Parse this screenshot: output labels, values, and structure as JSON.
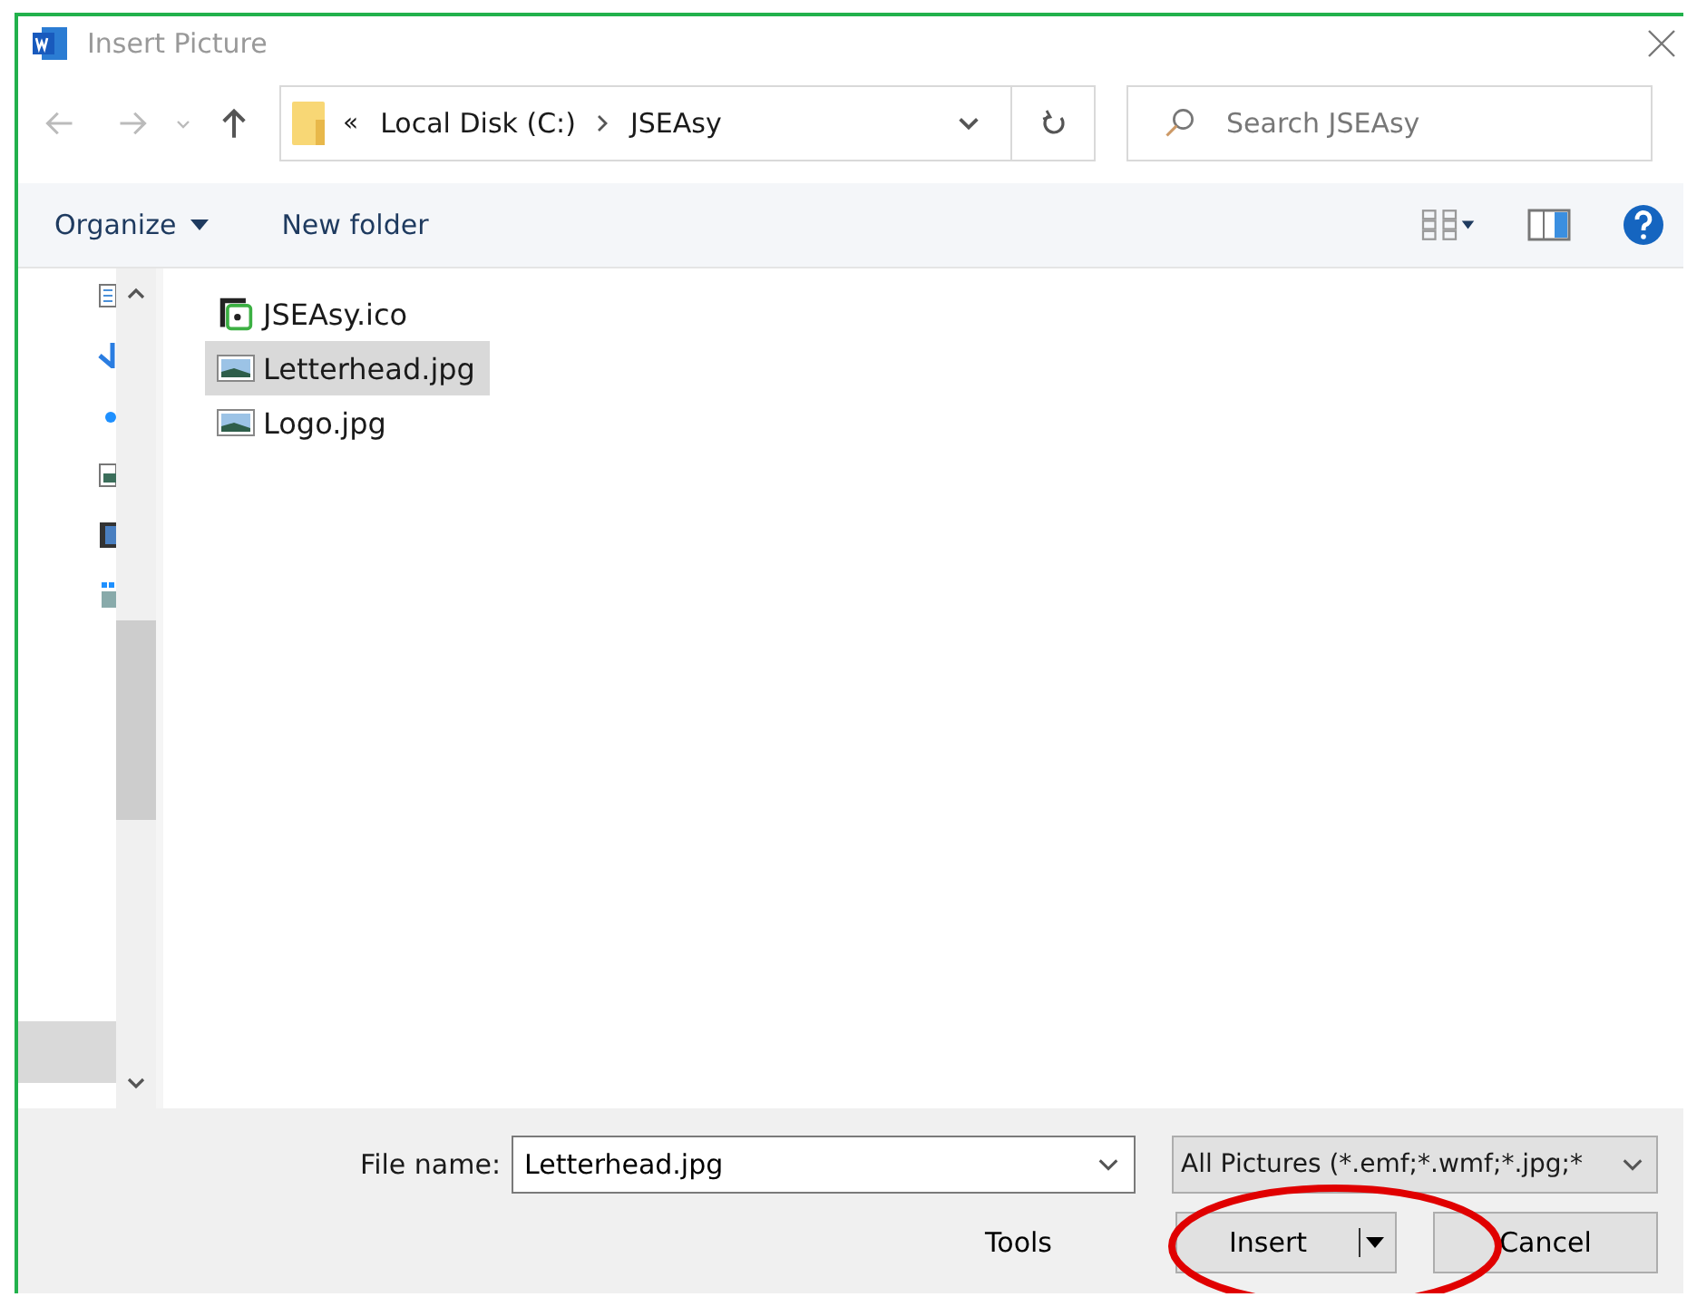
{
  "window": {
    "title": "Insert Picture"
  },
  "address": {
    "overflow": "«",
    "crumbs": [
      "Local Disk (C:)",
      "JSEAsy"
    ]
  },
  "search": {
    "placeholder": "Search JSEAsy"
  },
  "toolbar": {
    "organize": "Organize",
    "new_folder": "New folder"
  },
  "files": [
    {
      "name": "JSEAsy.ico",
      "kind": "icon",
      "selected": false
    },
    {
      "name": "Letterhead.jpg",
      "kind": "image",
      "selected": true
    },
    {
      "name": "Logo.jpg",
      "kind": "image",
      "selected": false
    }
  ],
  "footer": {
    "file_name_label": "File name:",
    "file_name": "Letterhead.jpg",
    "file_type": "All Pictures (*.emf;*.wmf;*.jpg;*",
    "tools": "Tools",
    "insert": "Insert",
    "cancel": "Cancel"
  }
}
